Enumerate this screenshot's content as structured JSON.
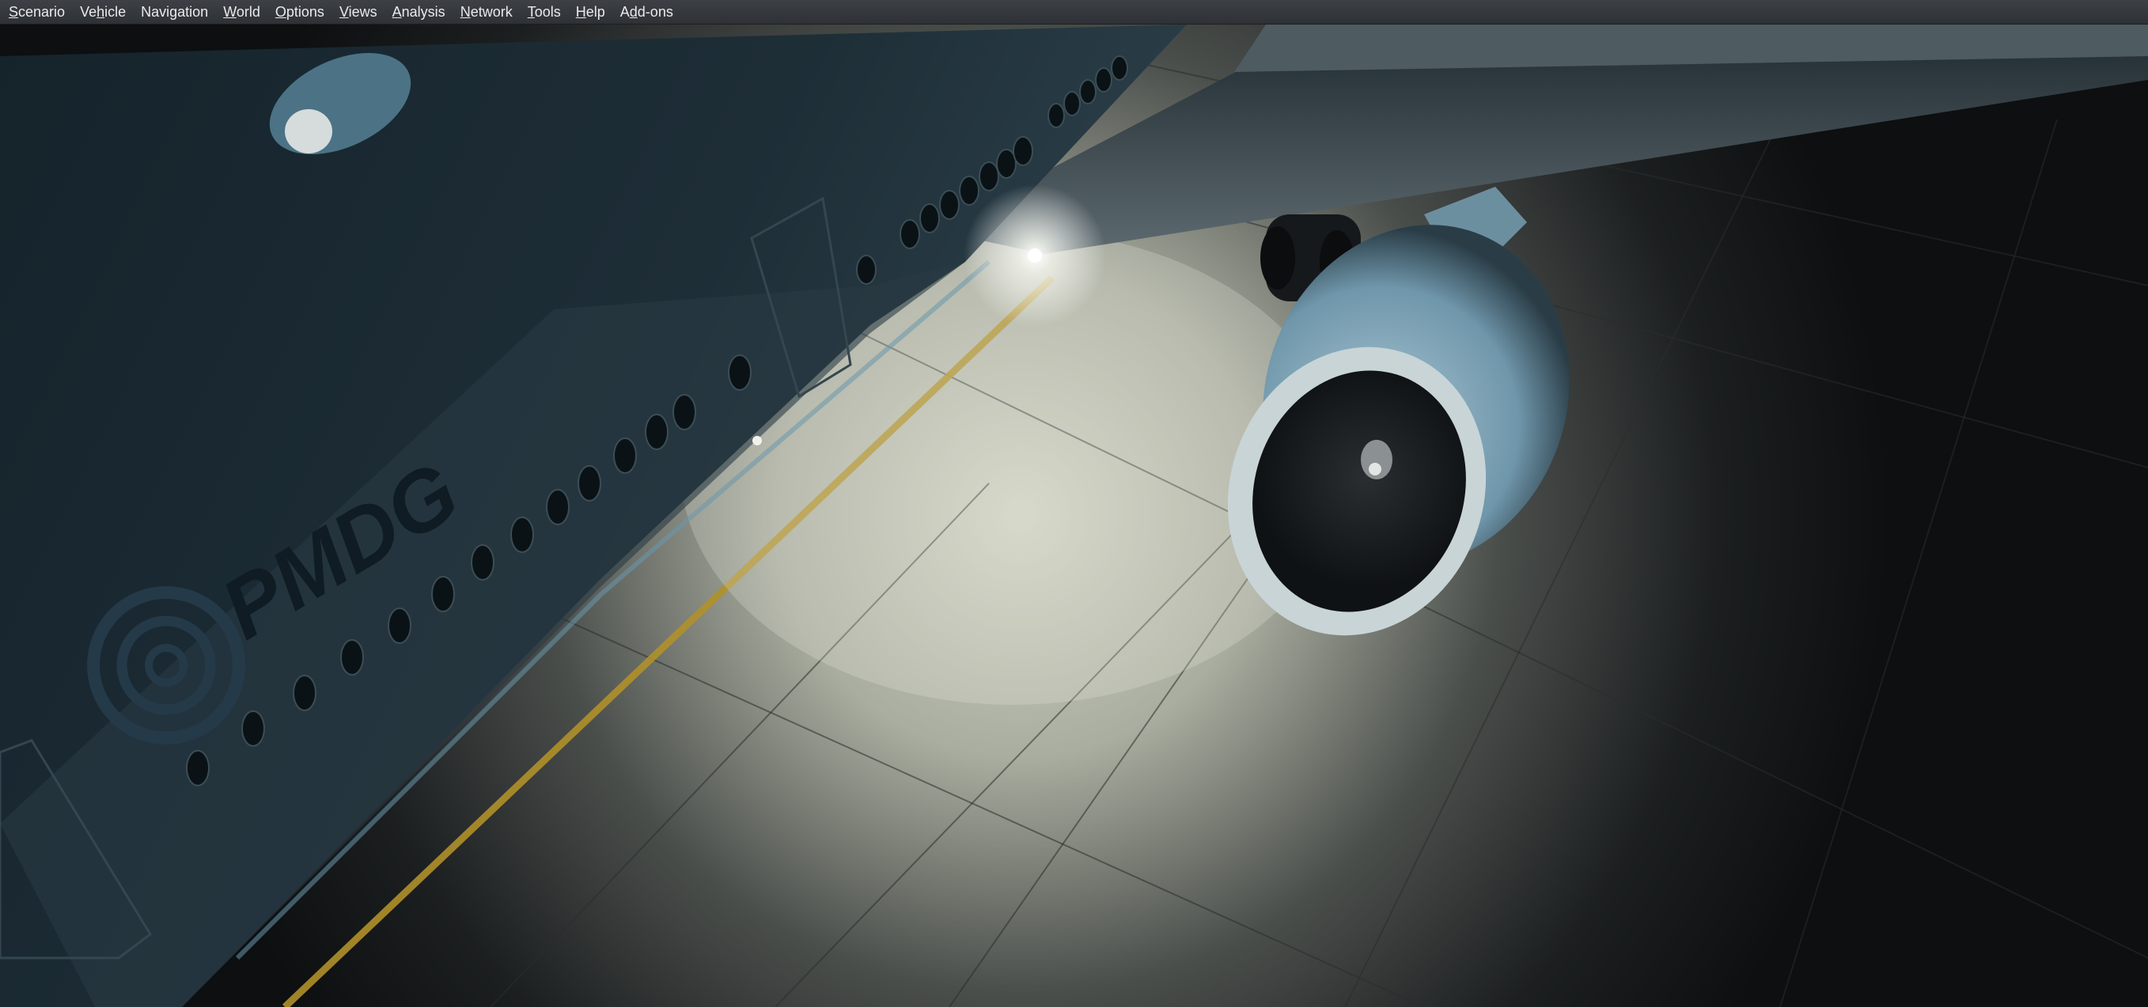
{
  "menubar": {
    "items": [
      {
        "label": "Scenario",
        "mnemonic": "S"
      },
      {
        "label": "Vehicle",
        "mnemonic": "h"
      },
      {
        "label": "Navigation",
        "mnemonic": ""
      },
      {
        "label": "World",
        "mnemonic": "W"
      },
      {
        "label": "Options",
        "mnemonic": "O"
      },
      {
        "label": "Views",
        "mnemonic": "V"
      },
      {
        "label": "Analysis",
        "mnemonic": "A"
      },
      {
        "label": "Network",
        "mnemonic": "N"
      },
      {
        "label": "Tools",
        "mnemonic": "T"
      },
      {
        "label": "Help",
        "mnemonic": "H"
      },
      {
        "label": "Add-ons",
        "mnemonic": "d"
      }
    ]
  },
  "scene": {
    "livery_text": "PMDG",
    "colors": {
      "fuselage": "#1b2a33",
      "apron_lit": "#c7cbbd",
      "apron_dark": "#121516",
      "taxi_line": "#b0902a",
      "nacelle": "#8fb4c6"
    }
  }
}
